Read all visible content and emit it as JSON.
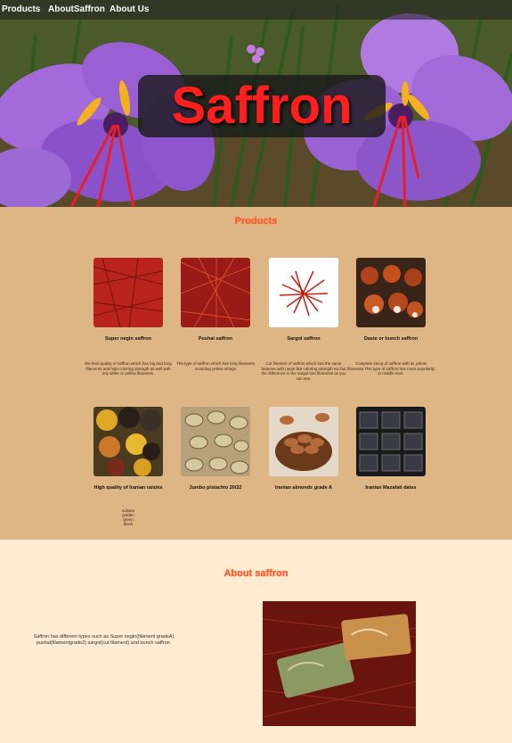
{
  "nav": {
    "products": "Products",
    "about_saffron": "AboutSaffron",
    "about_us": "About Us"
  },
  "hero": {
    "title": "Saffron"
  },
  "products": {
    "heading": "Products",
    "items": [
      {
        "name": "Super negin saffron",
        "desc": "the best quality of saffron which has big and long filaments and high coloring strength as well with any white or yellow filaments."
      },
      {
        "name": "Pushal saffron",
        "desc": "The type of saffron which has long filaments including yellow strings"
      },
      {
        "name": "Sargol saffron",
        "desc": "Cut filament of saffron which has the same features with negin like coloring strength etc but the difference is the sargol has filaments as you can see."
      },
      {
        "name": "Daste or bunch saffron",
        "desc": "Complete string of saffron with its yellow filaments.This type of saffron has more popularity in middle east."
      },
      {
        "name": "High quality of Iranian raisins",
        "list": [
          "sultans",
          "golden",
          "green",
          "black"
        ]
      },
      {
        "name": "Jumbo pistachio 20/22"
      },
      {
        "name": "Iranian almonds grade A"
      },
      {
        "name": "Iranian Mazafati dates"
      }
    ]
  },
  "about": {
    "heading": "About saffron",
    "text": "Saffron has different types such as Super negin(filament gradeA) pushal(filamentgrade2) sargol(cut filament) and bunch saffron."
  },
  "colors": {
    "products_bg": "#deb585",
    "about_bg": "#fdebd2",
    "heading": "#ff5a2a",
    "title_red": "#ff1f1f"
  }
}
